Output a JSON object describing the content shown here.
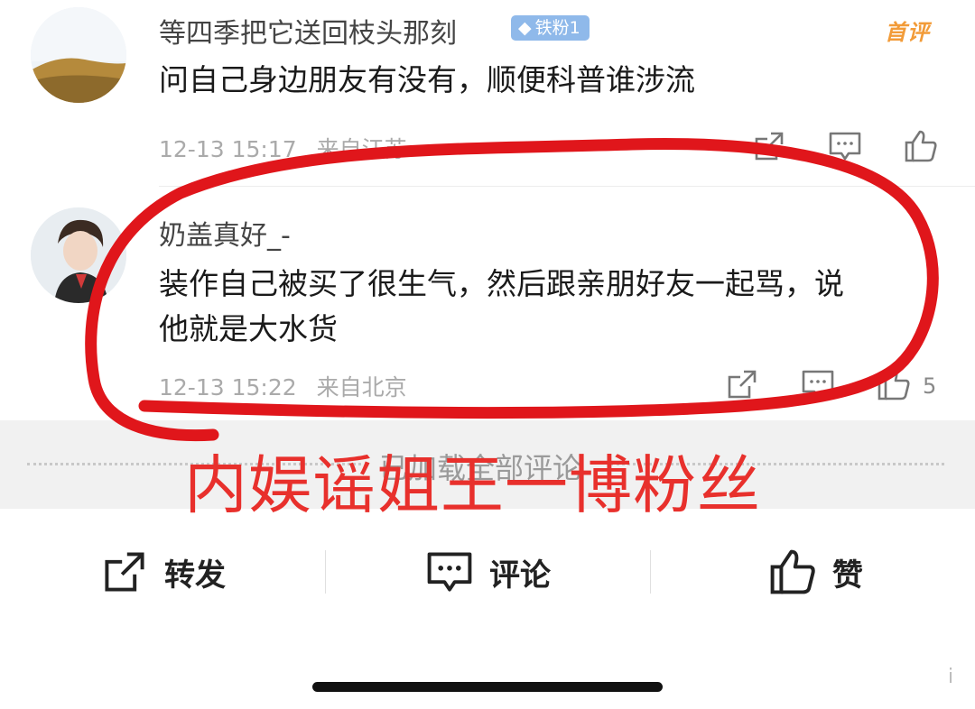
{
  "comments": [
    {
      "username": "等四季把它送回枝头那刻",
      "badge": "铁粉1",
      "badge_icon": "diamond-icon",
      "tag": "首评",
      "text": "问自己身边朋友有没有，顺便科普谁涉流",
      "time": "12-13 15:17",
      "location": "来自江苏"
    },
    {
      "username": "奶盖真好_-",
      "text_lines": [
        "装作自己被买了很生气，然后跟亲朋好友一起骂，说",
        "他就是大水货"
      ],
      "time": "12-13 15:22",
      "location": "来自北京",
      "like_count": "5"
    }
  ],
  "load_all": "已加载全部评论",
  "bottom_bar": {
    "repost": "转发",
    "comment": "评论",
    "like": "赞"
  },
  "annotation": "内娱谣姐王一博粉丝",
  "watermark": "i",
  "colors": {
    "annotation_red": "#e8302c",
    "badge_blue": "#8fb9ea",
    "first_comment_orange": "#f29b38"
  }
}
